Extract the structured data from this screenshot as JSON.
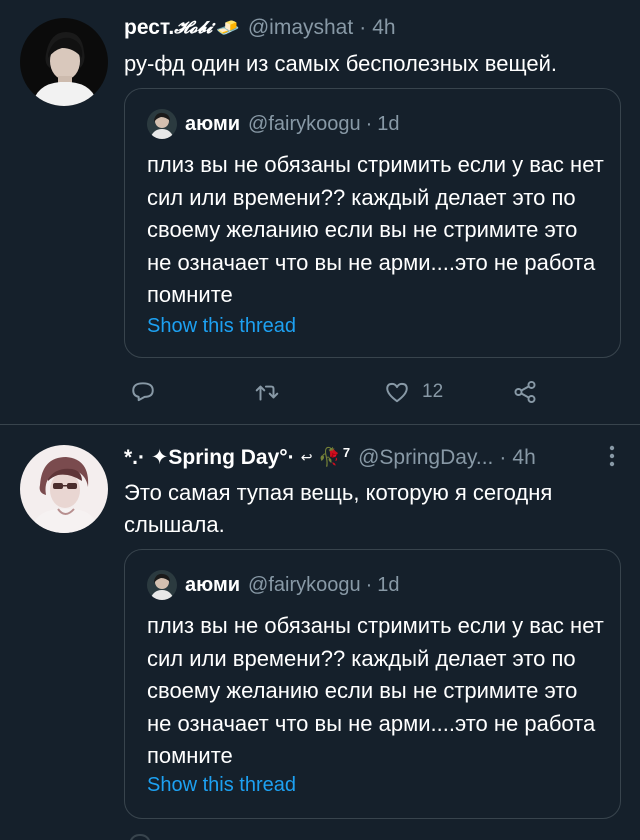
{
  "tweets": [
    {
      "author_name": "рест.",
      "author_name_suffix": "𝓗𝓸𝓫𝓲",
      "author_emoji": "🧈",
      "handle": "@imayshat",
      "time_sep": "·",
      "time": "4h",
      "text": "ру-фд один из самых бесполезных вещей.",
      "quote": {
        "author_name": "аюми",
        "handle": "@fairykoogu",
        "time_sep": "·",
        "time": "1d",
        "text": "плиз вы не обязаны стримить если у вас нет сил или времени?? каждый делает это по своему желанию если вы не стримите это не означает что вы не арми....это не работа помните",
        "show_thread": "Show this thread"
      },
      "actions": {
        "reply_icon": "reply-icon",
        "retweet_icon": "retweet-icon",
        "like_icon": "like-icon",
        "like_count": "12",
        "share_icon": "share-icon"
      }
    },
    {
      "author_name": "*.· ✦Spring Day°·",
      "author_emoji": "🥀",
      "author_sup": "7",
      "handle": "@SpringDay...",
      "time_sep": "·",
      "time": "4h",
      "text": "Это самая тупая вещь, которую я сегодня слышала.",
      "quote": {
        "author_name": "аюми",
        "handle": "@fairykoogu",
        "time_sep": "·",
        "time": "1d",
        "text": "плиз вы не обязаны стримить если у вас нет сил или времени?? каждый делает это по своему желанию если вы не стримите это не означает что вы не арми....это не работа помните",
        "show_thread": "Show this thread"
      }
    }
  ],
  "colors": {
    "background": "#15202b",
    "border": "#38444d",
    "muted": "#8899a6",
    "link": "#1da1f2"
  }
}
